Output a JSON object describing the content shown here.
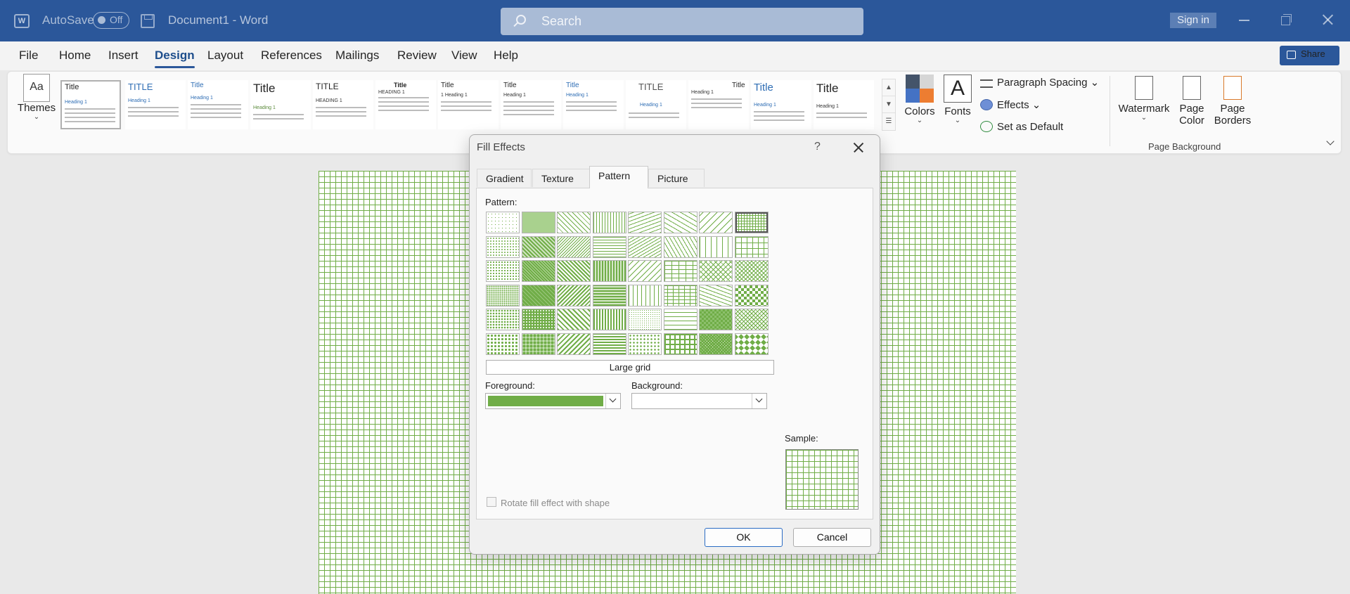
{
  "titlebar": {
    "autosave_label": "AutoSave",
    "autosave_state": "Off",
    "doc_title": "Document1  -  Word",
    "search_placeholder": "Search",
    "signin": "Sign in",
    "word_icon": "W"
  },
  "menu": {
    "tabs": [
      "File",
      "Home",
      "Insert",
      "Design",
      "Layout",
      "References",
      "Mailings",
      "Review",
      "View",
      "Help"
    ],
    "active": "Design",
    "share": "Share"
  },
  "ribbon": {
    "themes_label": "Themes",
    "themes_icon": "Aa",
    "gallery_items": [
      {
        "title": "Title",
        "heading": "Heading 1"
      },
      {
        "title": "TITLE",
        "heading": "Heading 1"
      },
      {
        "title": "Title",
        "heading": "Heading 1"
      },
      {
        "title": "Title",
        "heading": "Heading 1"
      },
      {
        "title": "TITLE",
        "heading": "HEADING 1"
      },
      {
        "title": "Title",
        "heading": "HEADING 1"
      },
      {
        "title": "Title",
        "heading": "1  Heading 1"
      },
      {
        "title": "Title",
        "heading": "Heading 1"
      },
      {
        "title": "Title",
        "heading": "Heading 1"
      },
      {
        "title": "TITLE",
        "heading": "Heading 1"
      },
      {
        "title": "Title",
        "heading": "Heading 1"
      },
      {
        "title": "Title",
        "heading": "Heading 1"
      },
      {
        "title": "Title",
        "heading": "Heading 1"
      }
    ],
    "colors_label": "Colors",
    "fonts_label": "Fonts",
    "fonts_icon": "A",
    "paragraph_spacing": "Paragraph Spacing",
    "effects": "Effects",
    "set_default": "Set as Default",
    "watermark": "Watermark",
    "page_color_1": "Page",
    "page_color_2": "Color",
    "page_borders_1": "Page",
    "page_borders_2": "Borders",
    "page_background_group": "Page Background",
    "theme_colors": [
      "#44546a",
      "#a5a5a5",
      "#4472c4",
      "#ed7d31"
    ]
  },
  "dialog": {
    "title": "Fill Effects",
    "help": "?",
    "tabs": [
      "Gradient",
      "Texture",
      "Pattern",
      "Picture"
    ],
    "active_tab": "Pattern",
    "pattern_label": "Pattern:",
    "pattern_name": "Large grid",
    "foreground_label": "Foreground:",
    "background_label": "Background:",
    "foreground_color": "#70ad47",
    "sample_label": "Sample:",
    "rotate_label": "Rotate fill effect with shape",
    "ok": "OK",
    "cancel": "Cancel"
  }
}
